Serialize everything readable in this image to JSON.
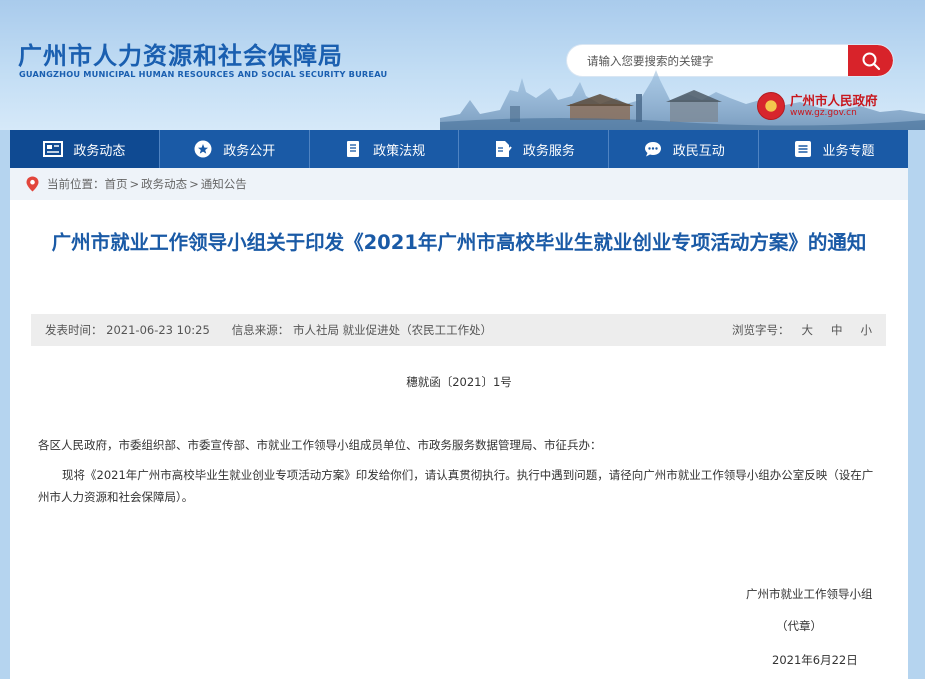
{
  "site": {
    "title_cn": "广州市人力资源和社会保障局",
    "title_en": "GUANGZHOU MUNICIPAL HUMAN RESOURCES AND SOCIAL SECURITY BUREAU"
  },
  "search": {
    "placeholder": "请输入您要搜索的关键字",
    "icon": "search-icon"
  },
  "gov_badge": {
    "name": "广州市人民政府",
    "url": "www.gz.gov.cn"
  },
  "nav": {
    "items": [
      {
        "label": "政务动态",
        "icon": "news-icon"
      },
      {
        "label": "政务公开",
        "icon": "star-icon"
      },
      {
        "label": "政策法规",
        "icon": "book-icon"
      },
      {
        "label": "政务服务",
        "icon": "service-icon"
      },
      {
        "label": "政民互动",
        "icon": "chat-icon"
      },
      {
        "label": "业务专题",
        "icon": "list-icon"
      }
    ]
  },
  "breadcrumb": {
    "prefix": "当前位置：",
    "items": [
      "首页",
      "政务动态",
      "通知公告"
    ],
    "sep": ">"
  },
  "article": {
    "title": "广州市就业工作领导小组关于印发《2021年广州市高校毕业生就业创业专项活动方案》的通知",
    "publish": "发表时间：  2021-06-23 10:25",
    "source": "信息来源：  市人社局 就业促进处（农民工工作处）",
    "font_size_label": "浏览字号：",
    "font_sizes": [
      "大",
      "中",
      "小"
    ],
    "doc_number": "穗就函〔2021〕1号",
    "recipients": "各区人民政府，市委组织部、市委宣传部、市就业工作领导小组成员单位、市政务服务数据管理局、市征兵办：",
    "body": "现将《2021年广州市高校毕业生就业创业专项活动方案》印发给你们，请认真贯彻执行。执行中遇到问题，请径向广州市就业工作领导小组办公室反映（设在广州市人力资源和社会保障局）。",
    "signer": "广州市就业工作领导小组",
    "signer_note": "（代章）",
    "date": "2021年6月22日"
  },
  "colors": {
    "brand_blue": "#1a5aa6",
    "search_red": "#d8232a",
    "gov_red": "#c8161d",
    "header_bg": "#b5d4ef"
  }
}
